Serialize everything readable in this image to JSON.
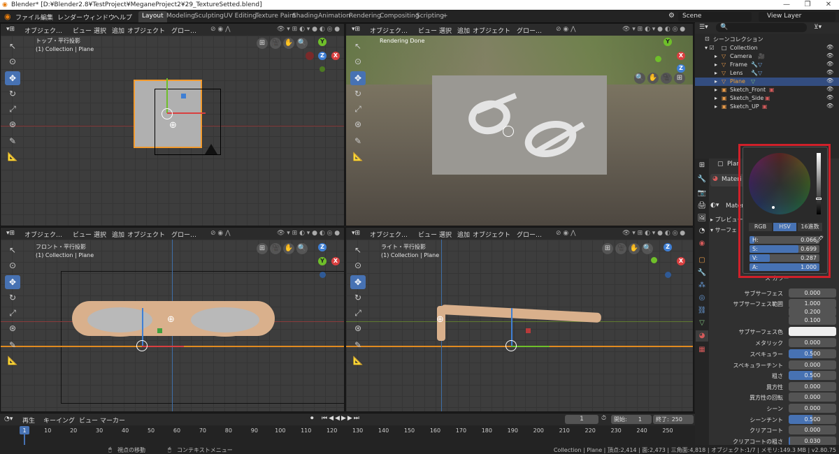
{
  "titlebar": {
    "title": "Blender* [D:¥Blender2.8¥TestProject¥MeganeProject2¥29_TextureSetted.blend]",
    "min": "—",
    "max": "❐",
    "close": "✕"
  },
  "topbar": {
    "menus": [
      "ファイル",
      "編集",
      "レンダー",
      "ウィンドウ",
      "ヘルプ"
    ],
    "workspaces": [
      "Layout",
      "Modeling",
      "Sculpting",
      "UV Editing",
      "Texture Paint",
      "Shading",
      "Animation",
      "Rendering",
      "Compositing",
      "Scripting",
      "+"
    ],
    "scene": "Scene",
    "view_layer": "View Layer"
  },
  "vp_header": {
    "mode": "オブジェク…",
    "view": "ビュー",
    "select": "選択",
    "add": "追加",
    "object": "オブジェクト",
    "orient": "グロー…"
  },
  "viewports": {
    "top": {
      "name": "トップ・平行投影",
      "collection": "(1) Collection | Plane"
    },
    "camera": {
      "status": "Rendering Done"
    },
    "front": {
      "name": "フロント・平行投影",
      "collection": "(1) Collection | Plane"
    },
    "right": {
      "name": "ライト・平行投影",
      "collection": "(1) Collection | Plane"
    }
  },
  "outliner": {
    "root": "シーンコレクション",
    "items": [
      "Collection",
      "Camera",
      "Frame",
      "Lens",
      "Plane",
      "Sketch_Front",
      "Sketch_Side",
      "Sketch_UP"
    ],
    "selected": "Plane"
  },
  "props": {
    "object": "Plan",
    "material": "Materi",
    "material2": "Materi",
    "preview": "プレビュー",
    "surface": "サーフェ",
    "section_partial": "ス カラー",
    "rows": [
      {
        "label": "サブサーフェス",
        "value": "0.000",
        "fill": 0
      },
      {
        "label": "サブサーフェス範囲",
        "value": "1.000",
        "fill": 0
      },
      {
        "label": "",
        "value": "0.200",
        "fill": 0
      },
      {
        "label": "",
        "value": "0.100",
        "fill": 0
      },
      {
        "label": "サブサーフェス色",
        "value": "",
        "fill": 0,
        "white": true
      },
      {
        "label": "メタリック",
        "value": "0.000",
        "fill": 0
      },
      {
        "label": "スペキュラー",
        "value": "0.500",
        "fill": 0.5
      },
      {
        "label": "スペキュラーチント",
        "value": "0.000",
        "fill": 0
      },
      {
        "label": "粗さ",
        "value": "0.500",
        "fill": 0.5
      },
      {
        "label": "異方性",
        "value": "0.000",
        "fill": 0
      },
      {
        "label": "異方性の回転",
        "value": "0.000",
        "fill": 0
      },
      {
        "label": "シーン",
        "value": "0.000",
        "fill": 0
      },
      {
        "label": "シーンチント",
        "value": "0.500",
        "fill": 0.5
      },
      {
        "label": "クリアコート",
        "value": "0.000",
        "fill": 0
      },
      {
        "label": "クリアコートの粗さ",
        "value": "0.030",
        "fill": 0.03
      }
    ]
  },
  "color_picker": {
    "tabs": [
      "RGB",
      "HSV",
      "16進数"
    ],
    "active_tab": "HSV",
    "fields": [
      {
        "key": "H:",
        "value": "0.066",
        "fill": 0.066
      },
      {
        "key": "S:",
        "value": "0.699",
        "fill": 0.699
      },
      {
        "key": "V:",
        "value": "0.287",
        "fill": 0.287
      },
      {
        "key": "A:",
        "value": "1.000",
        "fill": 1.0
      }
    ]
  },
  "timeline": {
    "menus": [
      "再生",
      "キーイング",
      "ビュー",
      "マーカー"
    ],
    "current_frame": "1",
    "start_label": "開始:",
    "start": "1",
    "end_label": "終了:",
    "end": "250",
    "frames": [
      "1",
      "10",
      "20",
      "30",
      "40",
      "50",
      "60",
      "70",
      "80",
      "90",
      "100",
      "110",
      "120",
      "130",
      "140",
      "150",
      "160",
      "170",
      "180",
      "190",
      "200",
      "210",
      "220",
      "230",
      "240",
      "250"
    ]
  },
  "statusbar": {
    "left": "視点の移動",
    "mid": "コンテキストメニュー",
    "right": "Collection | Plane | 頂点:2,414 | 面:2,473 | 三角面:4,818 | オブジェクト:1/7 | メモリ:149.3 MB | v2.80.75"
  }
}
